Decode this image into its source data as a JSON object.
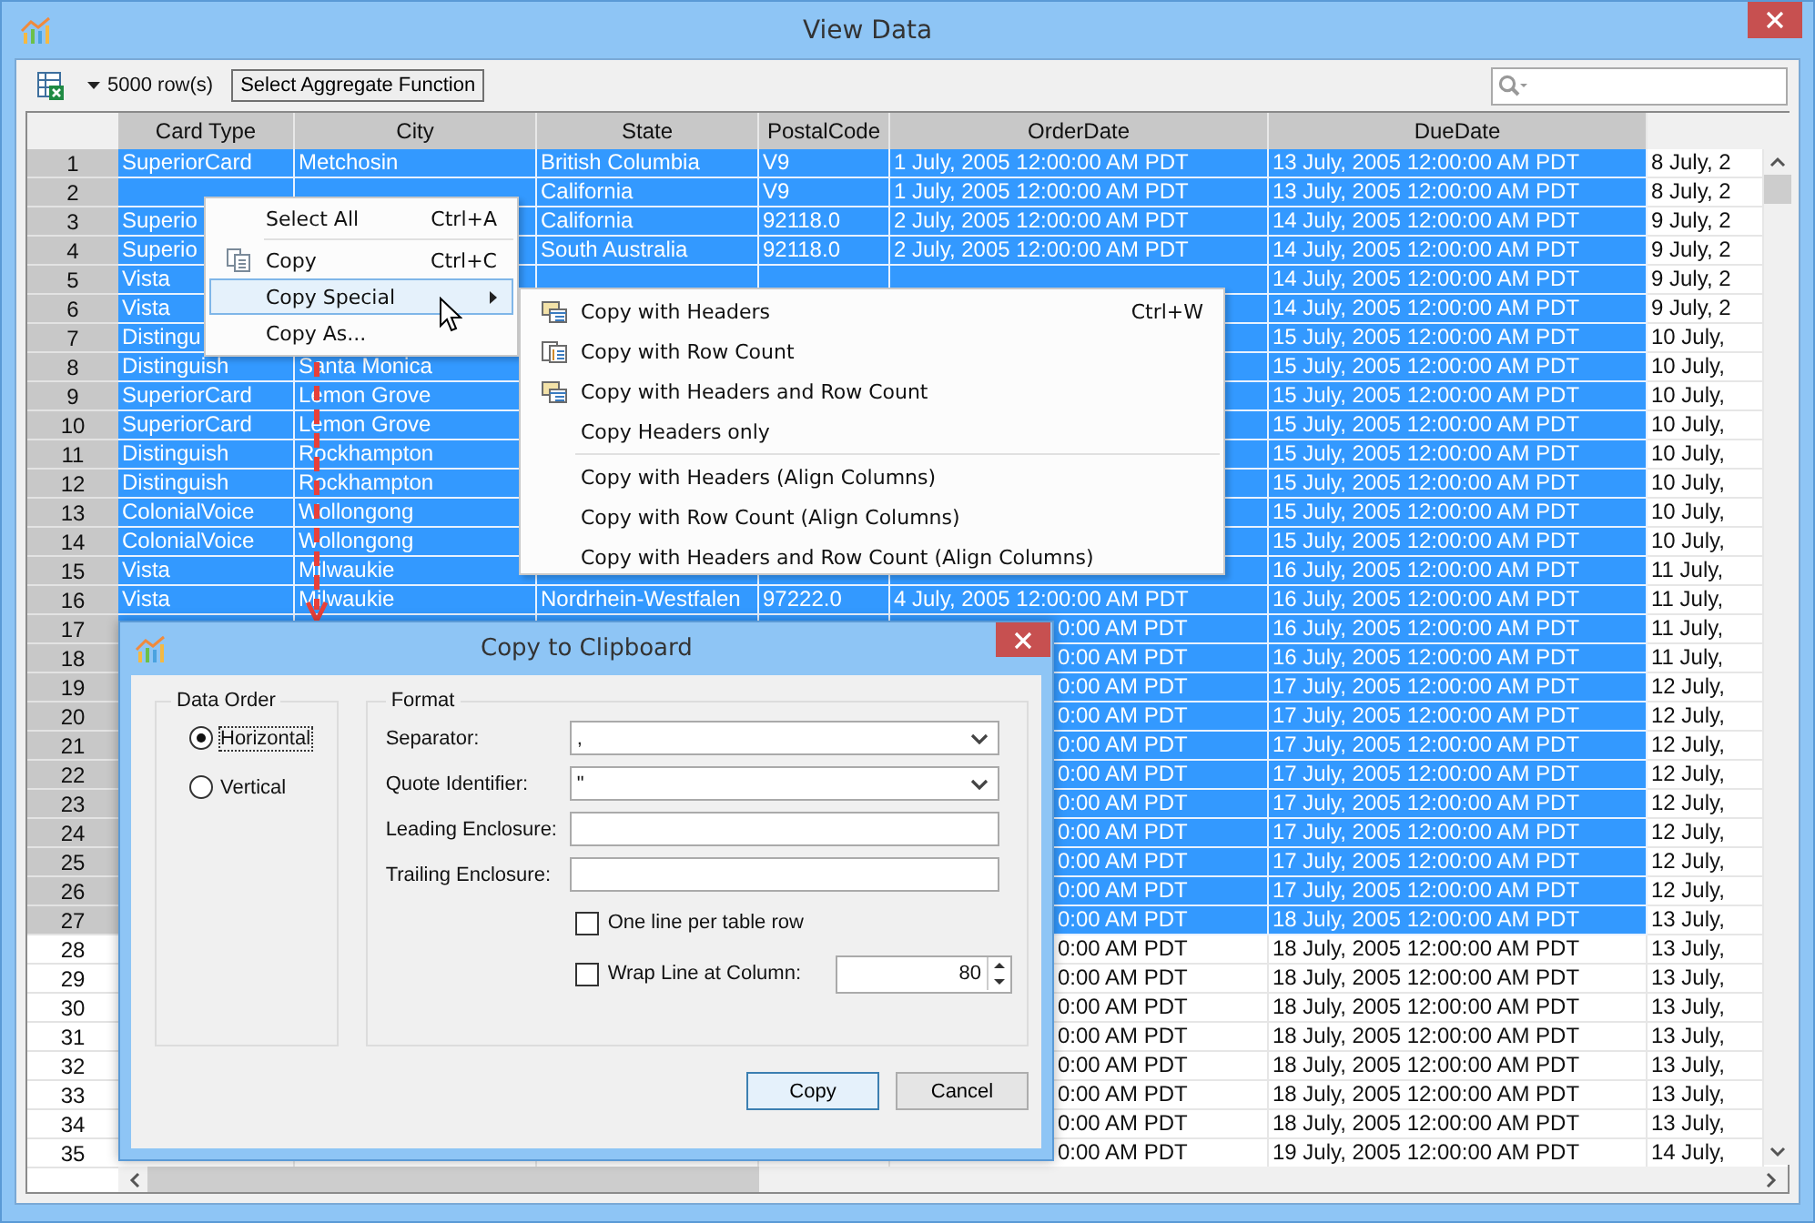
{
  "window": {
    "title": "View Data"
  },
  "toolbar": {
    "row_count": "5000 row(s)",
    "aggregate_button": "Select Aggregate Function"
  },
  "table": {
    "columns": [
      "Card Type",
      "City",
      "State",
      "PostalCode",
      "OrderDate",
      "DueDate"
    ],
    "rows": [
      {
        "number": "1",
        "selected": true,
        "card_type": "SuperiorCard",
        "city": "Metchosin",
        "state": "British Columbia",
        "postal_code": "V9",
        "order_date": "1 July, 2005 12:00:00 AM PDT",
        "due_date": "13 July, 2005 12:00:00 AM PDT",
        "column_7": "8 July, 2"
      },
      {
        "number": "2",
        "selected": true,
        "state": "California",
        "postal_code": "V9",
        "order_date": "1 July, 2005 12:00:00 AM PDT",
        "due_date": "13 July, 2005 12:00:00 AM PDT",
        "column_7": "8 July, 2"
      },
      {
        "number": "3",
        "selected": true,
        "card_type": "Superio",
        "state": "California",
        "postal_code": "92118.0",
        "order_date": "2 July, 2005 12:00:00 AM PDT",
        "due_date": "14 July, 2005 12:00:00 AM PDT",
        "column_7": "9 July, 2"
      },
      {
        "number": "4",
        "selected": true,
        "card_type": "Superio",
        "state": "South Australia",
        "postal_code": "92118.0",
        "order_date": "2 July, 2005 12:00:00 AM PDT",
        "due_date": "14 July, 2005 12:00:00 AM PDT",
        "column_7": "9 July, 2"
      },
      {
        "number": "5",
        "selected": true,
        "card_type": "Vista",
        "due_date": "14 July, 2005 12:00:00 AM PDT",
        "column_7": "9 July, 2"
      },
      {
        "number": "6",
        "selected": true,
        "card_type": "Vista",
        "due_date": "14 July, 2005 12:00:00 AM PDT",
        "column_7": "9 July, 2"
      },
      {
        "number": "7",
        "selected": true,
        "card_type": "Distingu",
        "due_date": "15 July, 2005 12:00:00 AM PDT",
        "column_7": "10 July,"
      },
      {
        "number": "8",
        "selected": true,
        "card_type": "Distinguish",
        "city": "Santa Monica",
        "due_date": "15 July, 2005 12:00:00 AM PDT",
        "column_7": "10 July,"
      },
      {
        "number": "9",
        "selected": true,
        "card_type": "SuperiorCard",
        "city": "Lemon Grove",
        "due_date": "15 July, 2005 12:00:00 AM PDT",
        "column_7": "10 July,"
      },
      {
        "number": "10",
        "selected": true,
        "card_type": "SuperiorCard",
        "city": "Lemon Grove",
        "due_date": "15 July, 2005 12:00:00 AM PDT",
        "column_7": "10 July,"
      },
      {
        "number": "11",
        "selected": true,
        "card_type": "Distinguish",
        "city": "Rockhampton",
        "due_date": "15 July, 2005 12:00:00 AM PDT",
        "column_7": "10 July,"
      },
      {
        "number": "12",
        "selected": true,
        "card_type": "Distinguish",
        "city": "Rockhampton",
        "due_date": "15 July, 2005 12:00:00 AM PDT",
        "column_7": "10 July,"
      },
      {
        "number": "13",
        "selected": true,
        "card_type": "ColonialVoice",
        "city": "Wollongong",
        "due_date": "15 July, 2005 12:00:00 AM PDT",
        "column_7": "10 July,"
      },
      {
        "number": "14",
        "selected": true,
        "card_type": "ColonialVoice",
        "city": "Wollongong",
        "due_date": "15 July, 2005 12:00:00 AM PDT",
        "column_7": "10 July,"
      },
      {
        "number": "15",
        "selected": true,
        "card_type": "Vista",
        "city": "Milwaukie",
        "due_date": "16 July, 2005 12:00:00 AM PDT",
        "column_7": "11 July,"
      },
      {
        "number": "16",
        "selected": true,
        "card_type": "Vista",
        "city": "Milwaukie",
        "state": "Nordrhein-Westfalen",
        "postal_code": "97222.0",
        "order_date": "4 July, 2005 12:00:00 AM PDT",
        "due_date": "16 July, 2005 12:00:00 AM PDT",
        "column_7": "11 July,"
      },
      {
        "number": "17",
        "selected": true,
        "order_date": "0:00 AM PDT",
        "due_date": "16 July, 2005 12:00:00 AM PDT",
        "column_7": "11 July,"
      },
      {
        "number": "18",
        "selected": true,
        "order_date": "0:00 AM PDT",
        "due_date": "16 July, 2005 12:00:00 AM PDT",
        "column_7": "11 July,"
      },
      {
        "number": "19",
        "selected": true,
        "order_date": "0:00 AM PDT",
        "due_date": "17 July, 2005 12:00:00 AM PDT",
        "column_7": "12 July,"
      },
      {
        "number": "20",
        "selected": true,
        "order_date": "0:00 AM PDT",
        "due_date": "17 July, 2005 12:00:00 AM PDT",
        "column_7": "12 July,"
      },
      {
        "number": "21",
        "selected": true,
        "order_date": "0:00 AM PDT",
        "due_date": "17 July, 2005 12:00:00 AM PDT",
        "column_7": "12 July,"
      },
      {
        "number": "22",
        "selected": true,
        "order_date": "0:00 AM PDT",
        "due_date": "17 July, 2005 12:00:00 AM PDT",
        "column_7": "12 July,"
      },
      {
        "number": "23",
        "selected": true,
        "order_date": "0:00 AM PDT",
        "due_date": "17 July, 2005 12:00:00 AM PDT",
        "column_7": "12 July,"
      },
      {
        "number": "24",
        "selected": true,
        "order_date": "0:00 AM PDT",
        "due_date": "17 July, 2005 12:00:00 AM PDT",
        "column_7": "12 July,"
      },
      {
        "number": "25",
        "selected": true,
        "order_date": "0:00 AM PDT",
        "due_date": "17 July, 2005 12:00:00 AM PDT",
        "column_7": "12 July,"
      },
      {
        "number": "26",
        "selected": true,
        "order_date": "0:00 AM PDT",
        "due_date": "17 July, 2005 12:00:00 AM PDT",
        "column_7": "12 July,"
      },
      {
        "number": "27",
        "selected": true,
        "order_date": "0:00 AM PDT",
        "due_date": "18 July, 2005 12:00:00 AM PDT",
        "column_7": "13 July,"
      },
      {
        "number": "28",
        "selected": false,
        "order_date": "0:00 AM PDT",
        "due_date": "18 July, 2005 12:00:00 AM PDT",
        "column_7": "13 July,"
      },
      {
        "number": "29",
        "selected": false,
        "order_date": "0:00 AM PDT",
        "due_date": "18 July, 2005 12:00:00 AM PDT",
        "column_7": "13 July,"
      },
      {
        "number": "30",
        "selected": false,
        "order_date": "0:00 AM PDT",
        "due_date": "18 July, 2005 12:00:00 AM PDT",
        "column_7": "13 July,"
      },
      {
        "number": "31",
        "selected": false,
        "order_date": "0:00 AM PDT",
        "due_date": "18 July, 2005 12:00:00 AM PDT",
        "column_7": "13 July,"
      },
      {
        "number": "32",
        "selected": false,
        "order_date": "0:00 AM PDT",
        "due_date": "18 July, 2005 12:00:00 AM PDT",
        "column_7": "13 July,"
      },
      {
        "number": "33",
        "selected": false,
        "order_date": "0:00 AM PDT",
        "due_date": "18 July, 2005 12:00:00 AM PDT",
        "column_7": "13 July,"
      },
      {
        "number": "34",
        "selected": false,
        "order_date": "0:00 AM PDT",
        "due_date": "18 July, 2005 12:00:00 AM PDT",
        "column_7": "13 July,"
      },
      {
        "number": "35",
        "selected": false,
        "order_date": "0:00 AM PDT",
        "due_date": "19 July, 2005 12:00:00 AM PDT",
        "column_7": "14 July,"
      }
    ]
  },
  "context_menu": {
    "items": [
      {
        "kind": "item",
        "label": "Select All",
        "shortcut": "Ctrl+A",
        "selected": false,
        "has_submenu": false
      },
      {
        "kind": "separator"
      },
      {
        "kind": "item",
        "label": "Copy",
        "shortcut": "Ctrl+C",
        "selected": false,
        "has_submenu": false
      },
      {
        "kind": "item",
        "label": "Copy Special",
        "selected": true,
        "has_submenu": true
      },
      {
        "kind": "item",
        "label": "Copy As...",
        "selected": false,
        "has_submenu": false
      }
    ]
  },
  "submenu": {
    "items": [
      {
        "kind": "item",
        "label": "Copy with Headers",
        "shortcut": "Ctrl+W"
      },
      {
        "kind": "item",
        "label": "Copy with Row Count"
      },
      {
        "kind": "item",
        "label": "Copy with Headers and Row Count"
      },
      {
        "kind": "item",
        "label": "Copy Headers only"
      },
      {
        "kind": "separator"
      },
      {
        "kind": "item",
        "label": "Copy with Headers (Align Columns)"
      },
      {
        "kind": "item",
        "label": "Copy with Row Count (Align Columns)"
      },
      {
        "kind": "item",
        "label": "Copy with Headers and Row Count (Align Columns)"
      }
    ]
  },
  "dialog": {
    "title": "Copy to Clipboard",
    "data_order": {
      "title": "Data Order",
      "options": [
        {
          "label": "Horizontal",
          "selected": true
        },
        {
          "label": "Vertical",
          "selected": false
        }
      ]
    },
    "format": {
      "title": "Format",
      "fields": [
        {
          "kind": "dropdown",
          "label": "Separator:",
          "value": ","
        },
        {
          "kind": "dropdown",
          "label": "Quote Identifier:",
          "value": "\""
        },
        {
          "kind": "text",
          "label": "Leading Enclosure:"
        },
        {
          "kind": "text",
          "label": "Trailing Enclosure:"
        }
      ],
      "options": [
        {
          "label": "One line per table row",
          "checked": false
        },
        {
          "label": "Wrap Line at Column:",
          "checked": false,
          "value": "80"
        }
      ]
    },
    "buttons": [
      "Copy",
      "Cancel"
    ]
  }
}
